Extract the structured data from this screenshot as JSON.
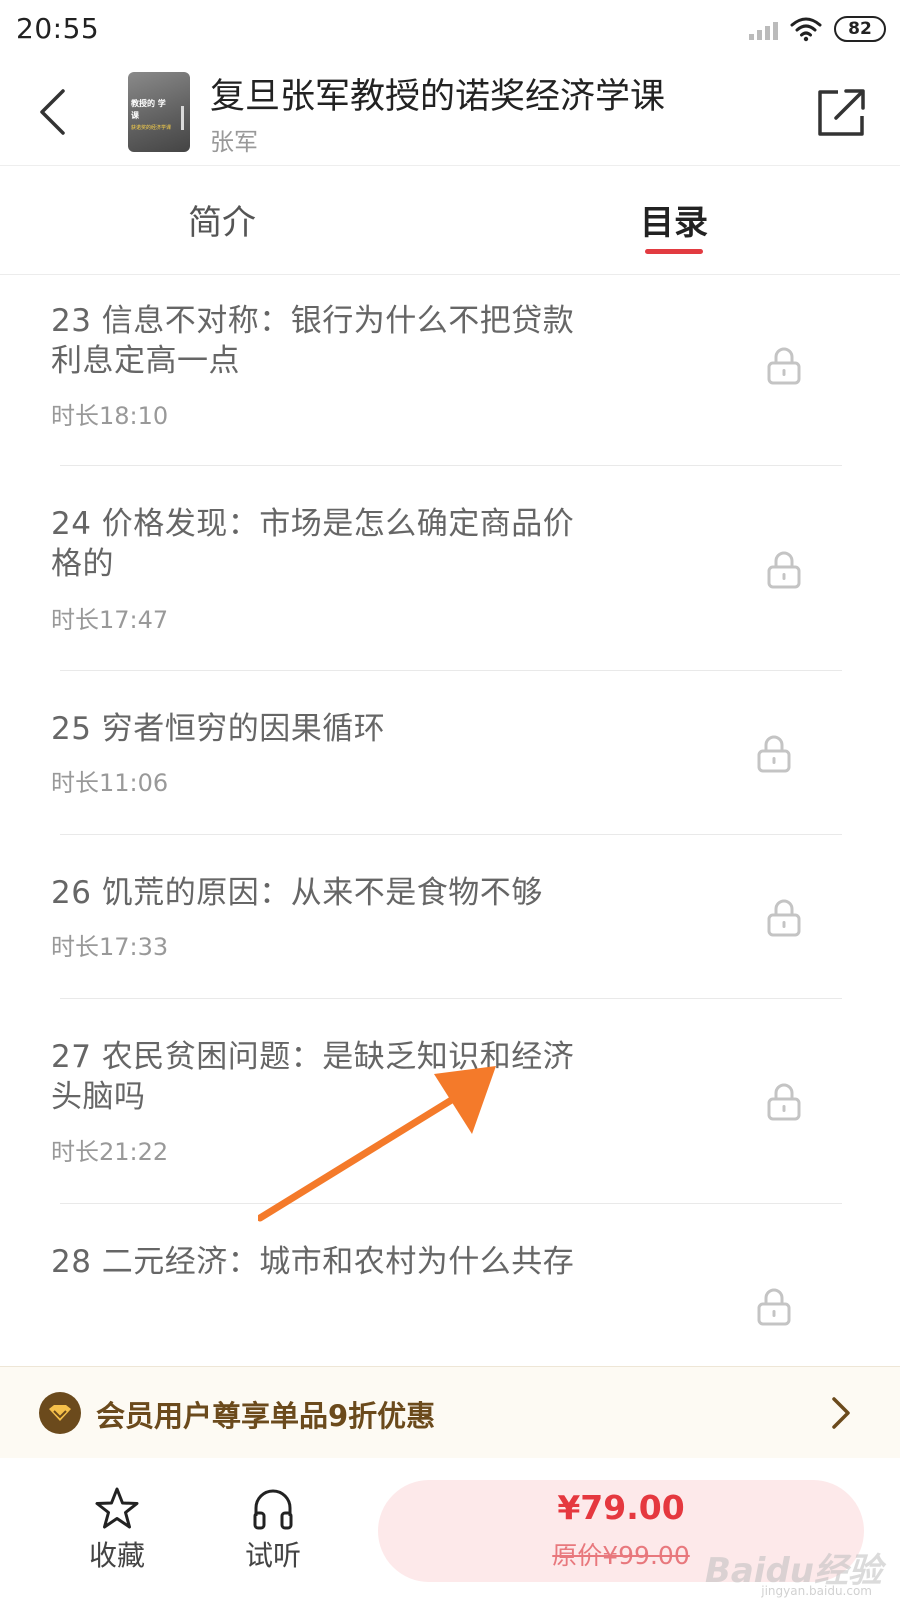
{
  "status_bar": {
    "time": "20:55",
    "battery": "82"
  },
  "header": {
    "title": "复旦张军教授的诺奖经济学课",
    "author": "张军",
    "cover_text": "教授的 学课",
    "cover_subtext": "获诺奖的经济学课"
  },
  "tabs": [
    {
      "label": "简介",
      "active": false
    },
    {
      "label": "目录",
      "active": true
    }
  ],
  "episodes": [
    {
      "title": "23 信息不对称：银行为什么不把贷款利息定高一点",
      "duration": "时长18:10",
      "locked": true
    },
    {
      "title": "24 价格发现：市场是怎么确定商品价格的",
      "duration": "时长17:47",
      "locked": true
    },
    {
      "title": "25 穷者恒穷的因果循环",
      "duration": "时长11:06",
      "locked": true
    },
    {
      "title": "26 饥荒的原因：从来不是食物不够",
      "duration": "时长17:33",
      "locked": true
    },
    {
      "title": "27 农民贫困问题：是缺乏知识和经济头脑吗",
      "duration": "时长21:22",
      "locked": true
    },
    {
      "title": "28 二元经济：城市和农村为什么共存",
      "duration": "",
      "locked": true
    }
  ],
  "member_banner": {
    "text": "会员用户尊享单品9折优惠"
  },
  "bottom_bar": {
    "favorite_label": "收藏",
    "listen_label": "试听",
    "price": "¥79.00",
    "original_price": "原价¥99.00"
  },
  "watermark": {
    "text": "Baidu经验",
    "sub": "jingyan.baidu.com"
  },
  "colors": {
    "accent": "#e23b41",
    "member_brown": "#6b4a1c",
    "arrow": "#f47a2a"
  },
  "icons": [
    "back-icon",
    "share-icon",
    "lock-icon",
    "crown-badge-icon",
    "chevron-right-icon",
    "star-icon",
    "headphones-icon"
  ]
}
